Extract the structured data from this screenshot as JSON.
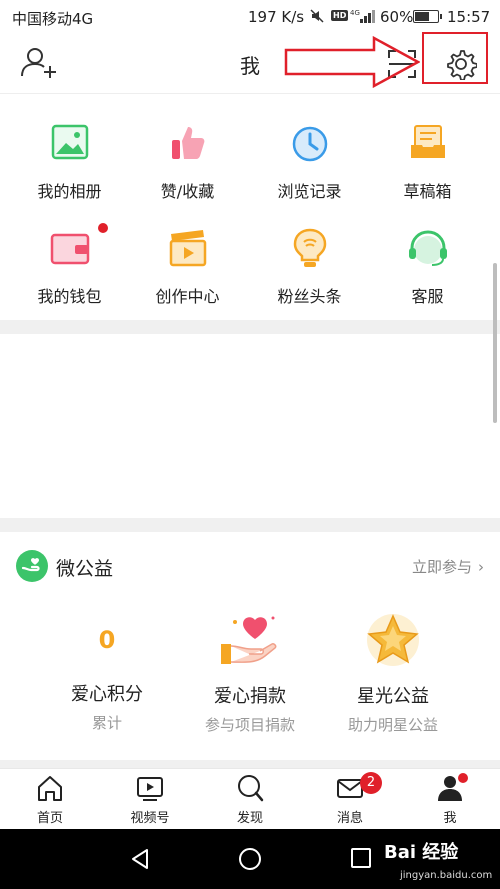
{
  "status_bar": {
    "carrier": "中国移动4G",
    "speed": "197 K/s",
    "hd": "HD",
    "battery": "60%",
    "time": "15:57"
  },
  "header": {
    "title": "我",
    "icons": [
      "add-user-icon",
      "scan-icon",
      "gear-icon"
    ]
  },
  "grid": {
    "items": [
      {
        "label": "我的相册",
        "icon": "photo-album-icon",
        "color": "#3cc46a"
      },
      {
        "label": "赞/收藏",
        "icon": "thumbs-up-icon",
        "color": "#f0506e"
      },
      {
        "label": "浏览记录",
        "icon": "clock-history-icon",
        "color": "#3a9be8"
      },
      {
        "label": "草稿箱",
        "icon": "draft-box-icon",
        "color": "#f5a623"
      },
      {
        "label": "我的钱包",
        "icon": "wallet-icon",
        "color": "#f0506e"
      },
      {
        "label": "创作中心",
        "icon": "clapperboard-icon",
        "color": "#f5a623"
      },
      {
        "label": "粉丝头条",
        "icon": "lightbulb-icon",
        "color": "#f5a623"
      },
      {
        "label": "客服",
        "icon": "headset-icon",
        "color": "#3cc46a"
      }
    ]
  },
  "charity": {
    "title": "微公益",
    "join_label": "立即参与",
    "items": [
      {
        "value": "0",
        "name": "爱心积分",
        "sub": "累计"
      },
      {
        "name": "爱心捐款",
        "sub": "参与项目捐款",
        "icon": "heart-hand-icon"
      },
      {
        "name": "星光公益",
        "sub": "助力明星公益",
        "icon": "star-badge-icon"
      }
    ]
  },
  "bottom_nav": {
    "items": [
      {
        "label": "首页",
        "icon": "home-icon"
      },
      {
        "label": "视频号",
        "icon": "video-play-icon"
      },
      {
        "label": "发现",
        "icon": "search-icon"
      },
      {
        "label": "消息",
        "icon": "mail-icon"
      },
      {
        "label": "我",
        "icon": "person-icon"
      }
    ],
    "message_badge": "2"
  },
  "watermark": {
    "text": "Bai 经验",
    "sub": "jingyan.baidu.com"
  },
  "colors": {
    "accent_red": "#e0202a",
    "gold": "#f5a623",
    "green": "#3cc46a"
  }
}
